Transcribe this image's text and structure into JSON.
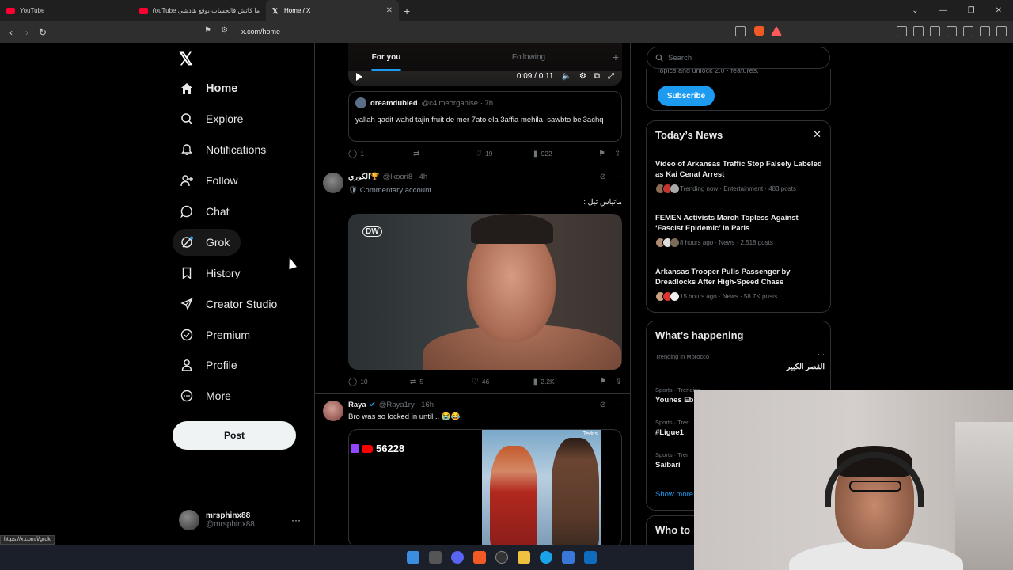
{
  "browser": {
    "tabs": [
      {
        "title": "YouTube",
        "favicon": "youtube-icon"
      },
      {
        "title": "ما كاتش فالحساب يوقع هادشي YouTube",
        "favicon": "youtube-icon"
      },
      {
        "title": "Home / X",
        "favicon": "x-icon",
        "active": true
      }
    ],
    "url": "x.com/home",
    "status_url": "https://x.com/i/grok"
  },
  "nav": {
    "items": [
      {
        "label": "Home",
        "icon": "home-icon",
        "active": true
      },
      {
        "label": "Explore",
        "icon": "search-icon"
      },
      {
        "label": "Notifications",
        "icon": "bell-icon"
      },
      {
        "label": "Follow",
        "icon": "person-add-icon"
      },
      {
        "label": "Chat",
        "icon": "chat-icon"
      },
      {
        "label": "Grok",
        "icon": "grok-icon",
        "hover": true
      },
      {
        "label": "History",
        "icon": "bookmark-icon"
      },
      {
        "label": "Creator Studio",
        "icon": "rocket-icon"
      },
      {
        "label": "Premium",
        "icon": "verified-icon"
      },
      {
        "label": "Profile",
        "icon": "person-icon"
      },
      {
        "label": "More",
        "icon": "more-circle-icon"
      }
    ],
    "post_label": "Post",
    "account": {
      "name": "mrsphinx88",
      "handle": "@mrsphinx88"
    }
  },
  "timeline": {
    "tabs": [
      "For you",
      "Following"
    ],
    "video": {
      "time": "0:09 / 0:11"
    },
    "quote": {
      "name": "dreamdubled",
      "handle": "@c4imeorganise · 7h",
      "text": "yallah qadit wahd tajin fruit de mer 7ato ela 3affia mehila, sawbto bel3achq"
    },
    "quote_actions": {
      "replies": "1",
      "reposts": "",
      "likes": "19",
      "views": "922"
    },
    "tweet1": {
      "name": "الكوري🏆",
      "handle": "@lkoori8 · 4h",
      "sub": "🛡 Commentary account",
      "text": "ماتياس تيل :",
      "watermark": "DW",
      "actions": {
        "replies": "10",
        "reposts": "5",
        "likes": "46",
        "views": "2.2K"
      }
    },
    "tweet2": {
      "name": "Raya",
      "handle": "@Raya1ry · 16h",
      "text": "Bro was so locked in until... 😭😂",
      "stream_count": "56228",
      "watermark": "Tedits"
    }
  },
  "right": {
    "search_placeholder": "Search",
    "premium_cut_text": "Topics and unlock 2.0 · features.",
    "subscribe_label": "Subscribe",
    "news_title": "Today’s News",
    "news": [
      {
        "title": "Video of Arkansas Traffic Stop Falsely Labeled as Kai Cenat Arrest",
        "meta": "Trending now · Entertainment · 483 posts"
      },
      {
        "title": "FEMEN Activists March Topless Against ‘Fascist Epidemic’ in Paris",
        "meta": "8 hours ago · News · 2,518 posts"
      },
      {
        "title": "Arkansas Trooper Pulls Passenger by Dreadlocks After High-Speed Chase",
        "meta": "15 hours ago · News · 58.7K posts"
      }
    ],
    "happening_title": "What’s happening",
    "trends": [
      {
        "category": "Trending in Morocco",
        "name": "القصر الكبير"
      },
      {
        "category": "Sports · Trending",
        "name": "Younes Eb"
      },
      {
        "category": "Sports · Trer",
        "name": "#Ligue1"
      },
      {
        "category": "Sports · Trer",
        "name": "Saibari"
      }
    ],
    "show_more": "Show more",
    "who_to_follow": "Who to"
  },
  "colors": {
    "accent": "#1d9bf0",
    "background": "#000000",
    "border": "#2f3336",
    "muted": "#71767b"
  }
}
